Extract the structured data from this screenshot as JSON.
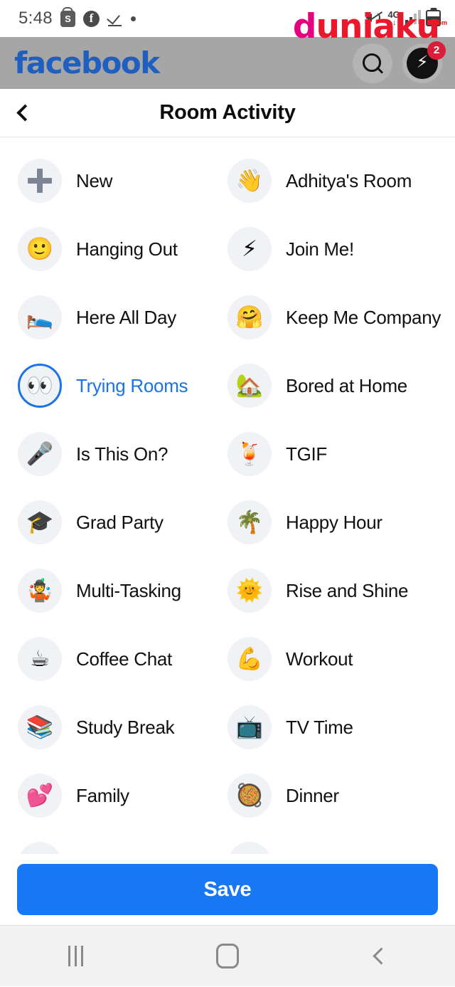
{
  "status_bar": {
    "time": "5:48",
    "left_icons": [
      "shopee-icon",
      "facebook-icon",
      "check-underline-icon",
      "dot-icon"
    ],
    "shopee_letter": "S",
    "facebook_letter": "f",
    "network_label": "4G",
    "battery_label": "om",
    "right_icons": [
      "mute-icon",
      "network-4g-icon",
      "signal-bars-icon",
      "battery-icon"
    ]
  },
  "watermark": {
    "first_letter": "d",
    "rest": "uniaku",
    "color_primary": "#e5007d",
    "color_secondary": "#e8192c"
  },
  "facebook_bar": {
    "logo": "facebook",
    "logo_color": "#1f5fbf",
    "bar_color": "#a6a6a6",
    "search_label": "Search",
    "messenger_label": "Messenger",
    "messenger_badge": "2",
    "badge_color": "#d81e38"
  },
  "header": {
    "back_label": "Back",
    "title": "Room Activity"
  },
  "activities": [
    {
      "label": "New",
      "emoji": "plus",
      "selected": false
    },
    {
      "label": "Adhitya's Room",
      "emoji": "👋",
      "selected": false
    },
    {
      "label": "Hanging Out",
      "emoji": "🙂",
      "selected": false
    },
    {
      "label": "Join Me!",
      "emoji": "⚡",
      "selected": false
    },
    {
      "label": "Here All Day",
      "emoji": "🛌",
      "selected": false
    },
    {
      "label": "Keep Me Company",
      "emoji": "🤗",
      "selected": false
    },
    {
      "label": "Trying Rooms",
      "emoji": "👀",
      "selected": true
    },
    {
      "label": "Bored at Home",
      "emoji": "🏡",
      "selected": false
    },
    {
      "label": "Is This On?",
      "emoji": "🎤",
      "selected": false
    },
    {
      "label": "TGIF",
      "emoji": "🍹",
      "selected": false
    },
    {
      "label": "Grad Party",
      "emoji": "🎓",
      "selected": false
    },
    {
      "label": "Happy Hour",
      "emoji": "🌴",
      "selected": false
    },
    {
      "label": "Multi-Tasking",
      "emoji": "🤹",
      "selected": false
    },
    {
      "label": "Rise and Shine",
      "emoji": "🌞",
      "selected": false
    },
    {
      "label": "Coffee Chat",
      "emoji": "☕",
      "selected": false
    },
    {
      "label": "Workout",
      "emoji": "💪",
      "selected": false
    },
    {
      "label": "Study Break",
      "emoji": "📚",
      "selected": false
    },
    {
      "label": "TV Time",
      "emoji": "📺",
      "selected": false
    },
    {
      "label": "Family",
      "emoji": "💕",
      "selected": false
    },
    {
      "label": "Dinner",
      "emoji": "🥘",
      "selected": false
    },
    {
      "label": "",
      "emoji": "",
      "selected": false
    },
    {
      "label": "",
      "emoji": "",
      "selected": false
    }
  ],
  "footer": {
    "save_label": "Save",
    "save_color": "#1877f2"
  },
  "nav_bar": {
    "recents_label": "Recents",
    "home_label": "Home",
    "back_label": "Back"
  }
}
